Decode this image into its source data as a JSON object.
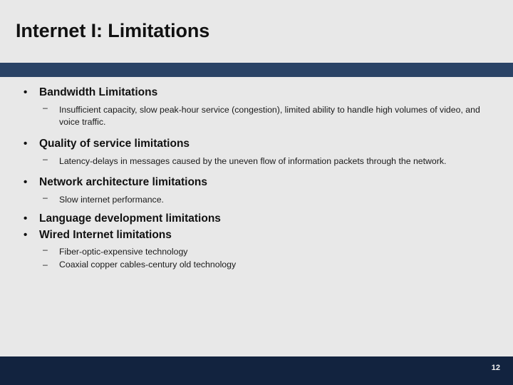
{
  "slide": {
    "title": "Internet I: Limitations",
    "bullet_marker": "•",
    "sub_marker": "–",
    "slide_number": "12",
    "colors": {
      "background": "#e8e8e8",
      "header_bar": "#2a4366",
      "footer_bar": "#12233f",
      "text": "#111111"
    },
    "groups": [
      {
        "heading": "Bandwidth Limitations",
        "items": [
          "Insufficient capacity, slow peak-hour service (congestion), limited ability to handle high volumes of video, and voice traffic."
        ]
      },
      {
        "heading": "Quality of service limitations",
        "items": [
          "Latency-delays in messages caused by the uneven flow of information packets through the network."
        ]
      },
      {
        "heading": "Network architecture limitations",
        "items": [
          "Slow internet performance."
        ]
      },
      {
        "heading": "Language development limitations",
        "items": []
      },
      {
        "heading": "Wired Internet limitations",
        "items": [
          "Fiber-optic-expensive technology",
          "Coaxial copper cables-century old technology"
        ]
      }
    ]
  }
}
